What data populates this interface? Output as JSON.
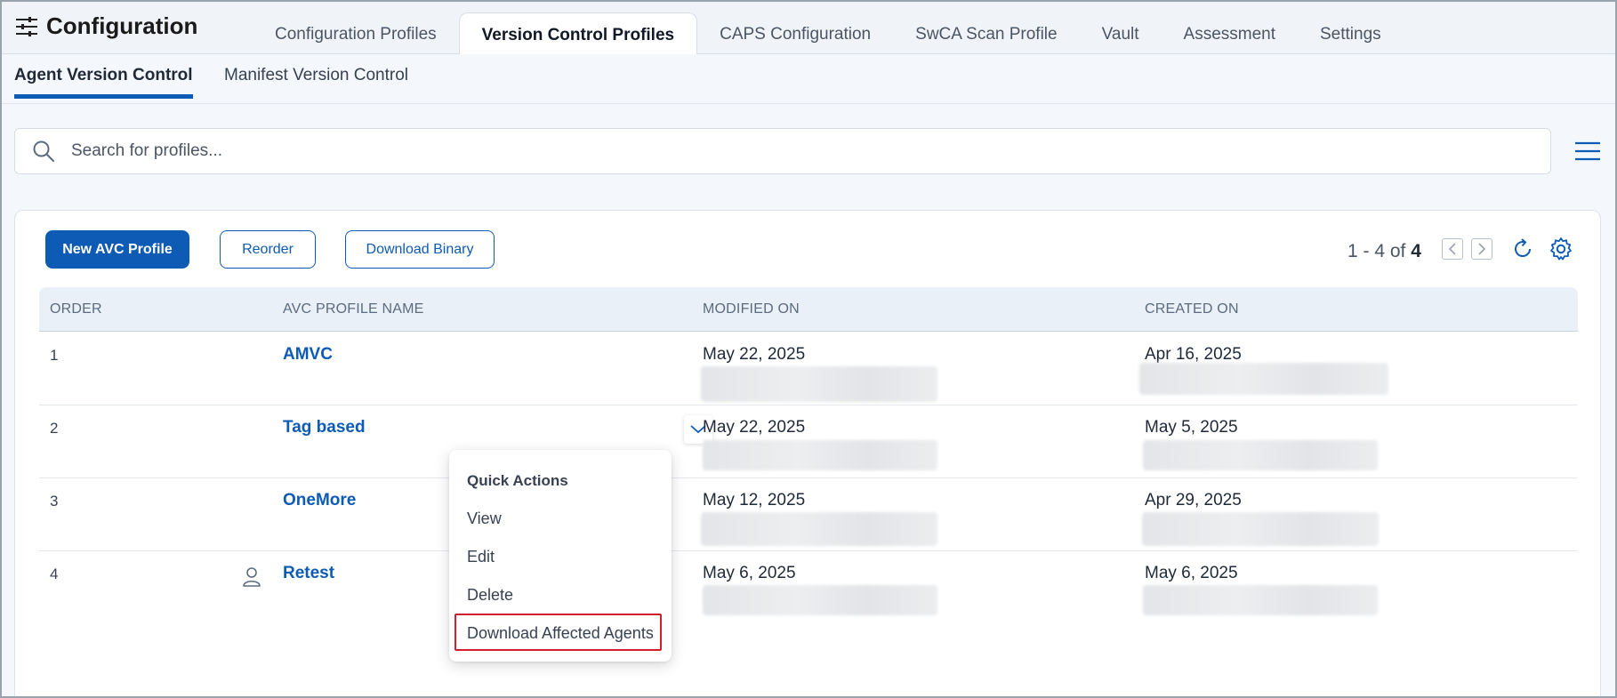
{
  "header": {
    "title": "Configuration",
    "tabs": [
      {
        "label": "Configuration Profiles"
      },
      {
        "label": "Version Control Profiles"
      },
      {
        "label": "CAPS Configuration"
      },
      {
        "label": "SwCA Scan Profile"
      },
      {
        "label": "Vault"
      },
      {
        "label": "Assessment"
      },
      {
        "label": "Settings"
      }
    ],
    "active_tab": "Version Control Profiles"
  },
  "subtabs": {
    "items": [
      {
        "label": "Agent Version Control"
      },
      {
        "label": "Manifest Version Control"
      }
    ],
    "active": "Agent Version Control"
  },
  "search": {
    "placeholder": "Search for profiles...",
    "value": ""
  },
  "toolbar": {
    "new_label": "New AVC Profile",
    "reorder_label": "Reorder",
    "download_binary_label": "Download Binary"
  },
  "pager": {
    "range": "1 - 4 of",
    "total": "4"
  },
  "table": {
    "columns": [
      "ORDER",
      "AVC PROFILE NAME",
      "MODIFIED ON",
      "CREATED ON"
    ],
    "rows": [
      {
        "order": "1",
        "name": "AMVC",
        "modified": "May 22, 2025",
        "created": "Apr 16, 2025"
      },
      {
        "order": "2",
        "name": "Tag based",
        "modified": "May 22, 2025",
        "created": "May 5, 2025"
      },
      {
        "order": "3",
        "name": "OneMore",
        "modified": "May 12, 2025",
        "created": "Apr 29, 2025"
      },
      {
        "order": "4",
        "name": "Retest",
        "modified": "May 6, 2025",
        "created": "May 6, 2025"
      }
    ]
  },
  "quick_actions": {
    "title": "Quick Actions",
    "items": [
      "View",
      "Edit",
      "Delete",
      "Download Affected Agents"
    ],
    "highlighted": "Download Affected Agents"
  },
  "colors": {
    "accent": "#0d5bb5",
    "highlight": "#d21f2b"
  }
}
